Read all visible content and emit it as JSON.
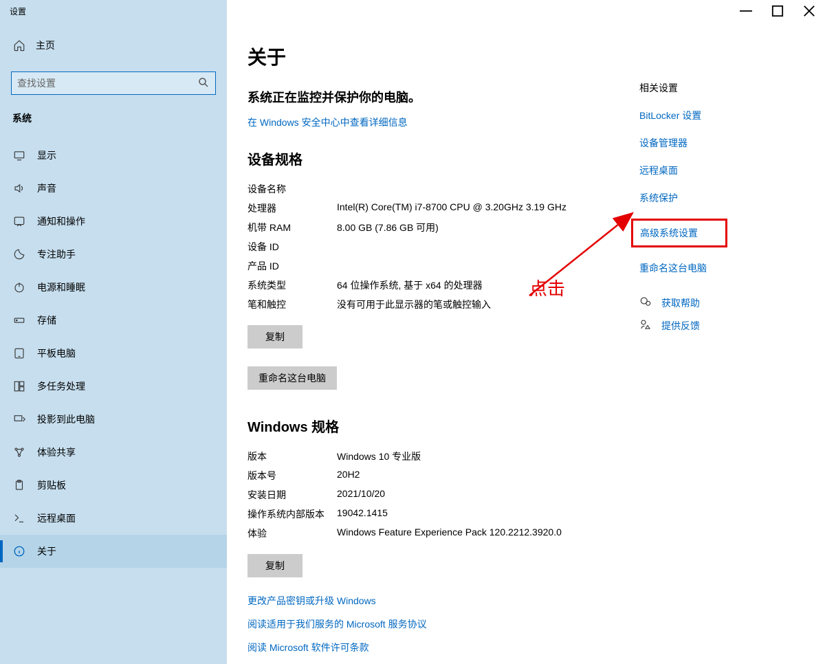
{
  "window": {
    "title": "设置"
  },
  "sidebar": {
    "home": "主页",
    "search_placeholder": "查找设置",
    "section": "系统",
    "items": [
      {
        "label": "显示"
      },
      {
        "label": "声音"
      },
      {
        "label": "通知和操作"
      },
      {
        "label": "专注助手"
      },
      {
        "label": "电源和睡眠"
      },
      {
        "label": "存储"
      },
      {
        "label": "平板电脑"
      },
      {
        "label": "多任务处理"
      },
      {
        "label": "投影到此电脑"
      },
      {
        "label": "体验共享"
      },
      {
        "label": "剪贴板"
      },
      {
        "label": "远程桌面"
      },
      {
        "label": "关于"
      }
    ]
  },
  "main": {
    "title": "关于",
    "protect": "系统正在监控并保护你的电脑。",
    "security_link": "在 Windows 安全中心中查看详细信息",
    "device_spec_title": "设备规格",
    "device_spec": [
      {
        "label": "设备名称",
        "value": ""
      },
      {
        "label": "处理器",
        "value": "Intel(R) Core(TM) i7-8700 CPU @ 3.20GHz   3.19 GHz"
      },
      {
        "label": "机带 RAM",
        "value": "8.00 GB (7.86 GB 可用)"
      },
      {
        "label": "设备 ID",
        "value": ""
      },
      {
        "label": "产品 ID",
        "value": ""
      },
      {
        "label": "系统类型",
        "value": "64 位操作系统, 基于 x64 的处理器"
      },
      {
        "label": "笔和触控",
        "value": "没有可用于此显示器的笔或触控输入"
      }
    ],
    "copy": "复制",
    "rename_pc": "重命名这台电脑",
    "win_spec_title": "Windows 规格",
    "win_spec": [
      {
        "label": "版本",
        "value": "Windows 10 专业版"
      },
      {
        "label": "版本号",
        "value": "20H2"
      },
      {
        "label": "安装日期",
        "value": "2021/10/20"
      },
      {
        "label": "操作系统内部版本",
        "value": "19042.1415"
      },
      {
        "label": "体验",
        "value": "Windows Feature Experience Pack 120.2212.3920.0"
      }
    ],
    "link_product_key": "更改产品密钥或升级 Windows",
    "link_services_agreement": "阅读适用于我们服务的 Microsoft 服务协议",
    "link_license_terms": "阅读 Microsoft 软件许可条款"
  },
  "related": {
    "title": "相关设置",
    "links": [
      "BitLocker 设置",
      "设备管理器",
      "远程桌面",
      "系统保护",
      "高级系统设置",
      "重命名这台电脑"
    ],
    "get_help": "获取帮助",
    "feedback": "提供反馈"
  },
  "annotation": {
    "text": "点击",
    "color": "#E30000"
  }
}
